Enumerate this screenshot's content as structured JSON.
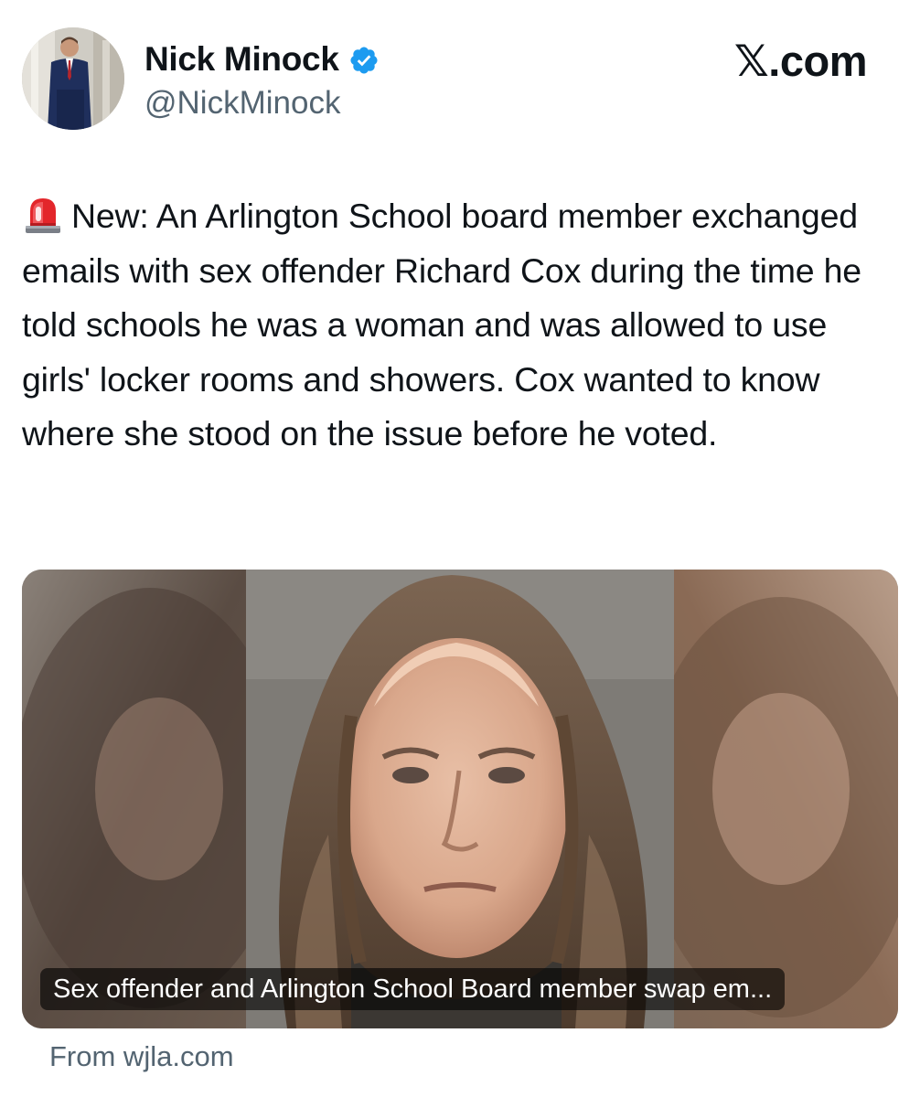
{
  "author": {
    "name": "Nick Minock",
    "handle": "@NickMinock",
    "verified": true
  },
  "site_brand": "𝕏.com",
  "tweet": {
    "text": "New: An Arlington School board member exchanged emails with sex offender Richard Cox during the time he told schools he was a woman and was allowed to use girls' locker rooms and showers. Cox wanted to know where she stood on the issue before he voted.",
    "leading_icon": "police-siren-emoji"
  },
  "link_card": {
    "caption": "Sex offender and Arlington School Board member swap em...",
    "source": "From wjla.com"
  },
  "colors": {
    "text_primary": "#0f1419",
    "text_secondary": "#536471",
    "verified_blue": "#1d9bf0",
    "background": "#ffffff"
  }
}
